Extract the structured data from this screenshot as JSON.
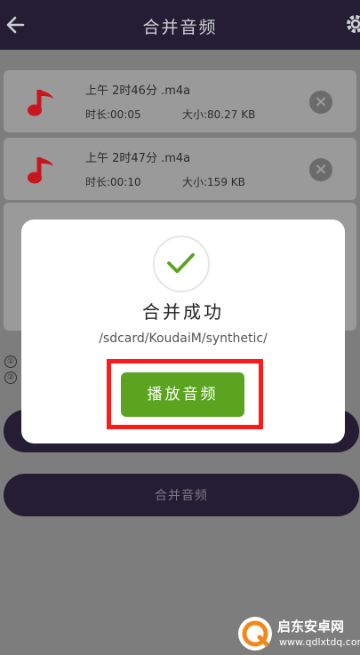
{
  "header": {
    "title": "合并音频"
  },
  "files": [
    {
      "name": "上午 2时46分 .m4a",
      "duration": "时长:00:05",
      "size": "大小:80.27 KB"
    },
    {
      "name": "上午 2时47分 .m4a",
      "duration": "时长:00:10",
      "size": "大小:159 KB"
    }
  ],
  "steps": [
    "①",
    "②"
  ],
  "merge_button": {
    "label": "合并音频"
  },
  "dialog": {
    "title": "合并成功",
    "path": "/sdcard/KoudaiM/synthetic/",
    "play_label": "播放音频"
  },
  "watermark": {
    "title": "启东安卓网",
    "url": "www.qdlxtdq.com"
  },
  "colors": {
    "accent": "#5aa41f",
    "header": "#241d33",
    "note": "#c8161e",
    "highlight": "#ff1a1a"
  }
}
